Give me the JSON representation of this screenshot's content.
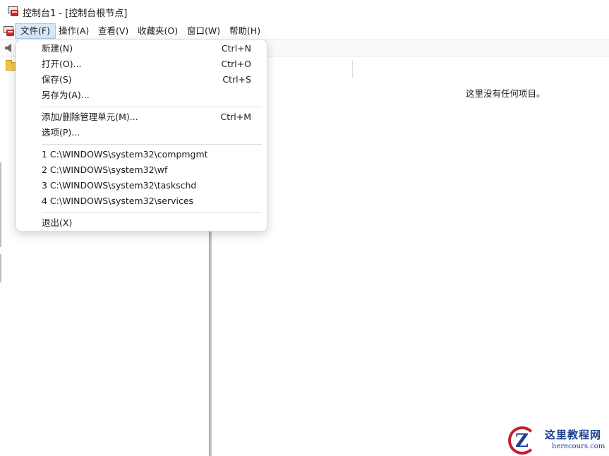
{
  "window": {
    "title": "控制台1 - [控制台根节点]"
  },
  "menubar": {
    "items": [
      "文件(F)",
      "操作(A)",
      "查看(V)",
      "收藏夹(O)",
      "窗口(W)",
      "帮助(H)"
    ],
    "active_index": 0
  },
  "file_menu": {
    "new_label": "新建(N)",
    "new_shortcut": "Ctrl+N",
    "open_label": "打开(O)...",
    "open_shortcut": "Ctrl+O",
    "save_label": "保存(S)",
    "save_shortcut": "Ctrl+S",
    "save_as_label": "另存为(A)...",
    "add_remove_label": "添加/删除管理单元(M)...",
    "add_remove_shortcut": "Ctrl+M",
    "options_label": "选项(P)...",
    "recent": [
      "1 C:\\WINDOWS\\system32\\compmgmt",
      "2 C:\\WINDOWS\\system32\\wf",
      "3 C:\\WINDOWS\\system32\\taskschd",
      "4 C:\\WINDOWS\\system32\\services"
    ],
    "exit_label": "退出(X)"
  },
  "result_pane": {
    "empty_message": "这里没有任何项目。"
  },
  "watermark": {
    "title": "这里教程网",
    "subtitle": "herecours.com"
  },
  "icons": {
    "app": "mmc-console-icon",
    "back": "back-arrow-icon",
    "tree_root": "folder-icon"
  }
}
